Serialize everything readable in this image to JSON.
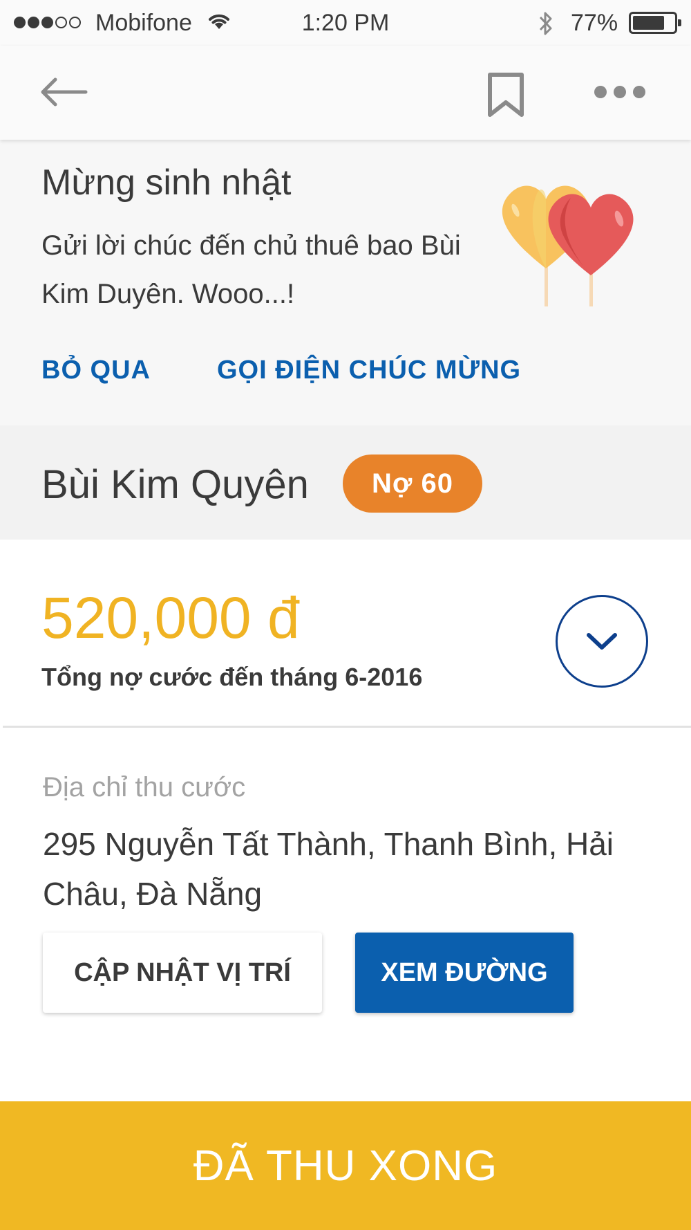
{
  "status_bar": {
    "carrier": "Mobifone",
    "time": "1:20 PM",
    "battery_percent": "77%",
    "battery_level": 0.77,
    "signal_strength": 3,
    "signal_max": 5
  },
  "nav": {
    "back_icon": "arrow-left-icon",
    "bookmark_icon": "bookmark-icon",
    "more_icon": "more-horizontal-icon"
  },
  "birthday": {
    "title": "Mừng sinh nhật",
    "message": "Gửi lời chúc đến chủ thuê bao Bùi Kim Duyên. Wooo...!",
    "skip_label": "BỎ QUA",
    "call_label": "GỌI ĐIỆN CHÚC MỪNG",
    "icon": "heart-balloons-icon"
  },
  "customer": {
    "name": "Bùi Kim Quyên",
    "debt_badge": "Nợ 60"
  },
  "billing": {
    "amount": "520,000 đ",
    "label": "Tổng nợ cước đến tháng 6-2016",
    "expand_icon": "chevron-down-icon"
  },
  "address": {
    "label": "Địa chỉ thu cước",
    "value": "295 Nguyễn Tất Thành, Thanh Bình, Hải Châu, Đà Nẵng",
    "update_button": "CẬP NHẬT VỊ TRÍ",
    "directions_button": "XEM ĐƯỜNG"
  },
  "cta": {
    "label": "ĐÃ THU XONG"
  },
  "colors": {
    "primary_blue": "#0b5fae",
    "accent_yellow": "#f0b823",
    "amount_yellow": "#f0b323",
    "badge_orange": "#e8832a",
    "text_dark": "#3a3a3a",
    "text_muted": "#a3a3a3"
  }
}
